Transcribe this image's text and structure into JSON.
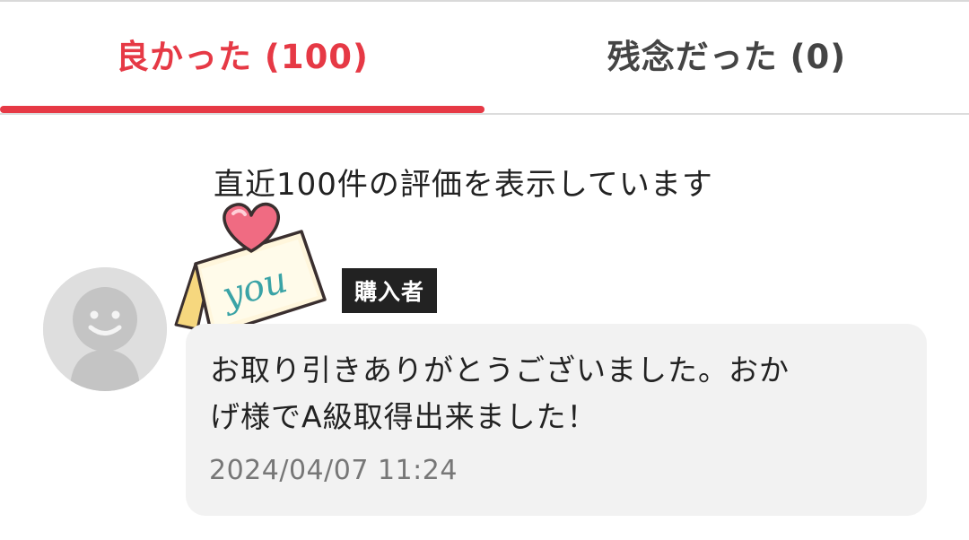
{
  "colors": {
    "accent": "#e63945",
    "tag_bg": "#222222"
  },
  "tabs": [
    {
      "label": "良かった (100)",
      "active": true
    },
    {
      "label": "残念だった (0)",
      "active": false
    }
  ],
  "notice": "直近100件の評価を表示しています",
  "review": {
    "avatar_icon": "default-user-avatar-icon",
    "badge_icon": "heart-you-card-icon",
    "badge_text": "you",
    "role_tag": "購入者",
    "comment_line1": "お取り引きありがとうございました。おか",
    "comment_line2": "げ様でA級取得出来ました！",
    "date": "2024/04/07 11:24"
  }
}
